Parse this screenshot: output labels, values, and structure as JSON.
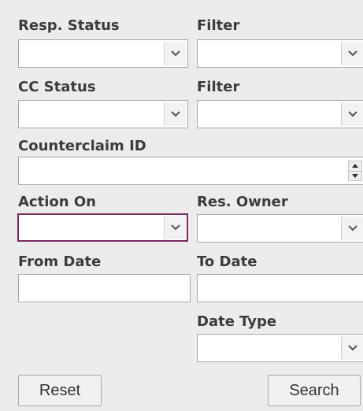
{
  "labels": {
    "resp_status": "Resp. Status",
    "filter_1": "Filter",
    "cc_status": "CC Status",
    "filter_2": "Filter",
    "counterclaim_id": "Counterclaim ID",
    "action_on": "Action On",
    "res_owner": "Res. Owner",
    "from_date": "From Date",
    "to_date": "To Date",
    "date_type": "Date Type"
  },
  "values": {
    "resp_status": "",
    "filter_1": "",
    "cc_status": "",
    "filter_2": "",
    "counterclaim_id": "",
    "action_on": "",
    "res_owner": "",
    "from_date": "",
    "to_date": "",
    "date_type": ""
  },
  "buttons": {
    "reset": "Reset",
    "search": "Search"
  },
  "icons": {
    "dropdown": "chevron-down-icon",
    "spinner": "spinner-icon"
  },
  "colors": {
    "background": "#ececec",
    "label": "#3c3c3c",
    "focus_border": "#7a2a5e"
  }
}
